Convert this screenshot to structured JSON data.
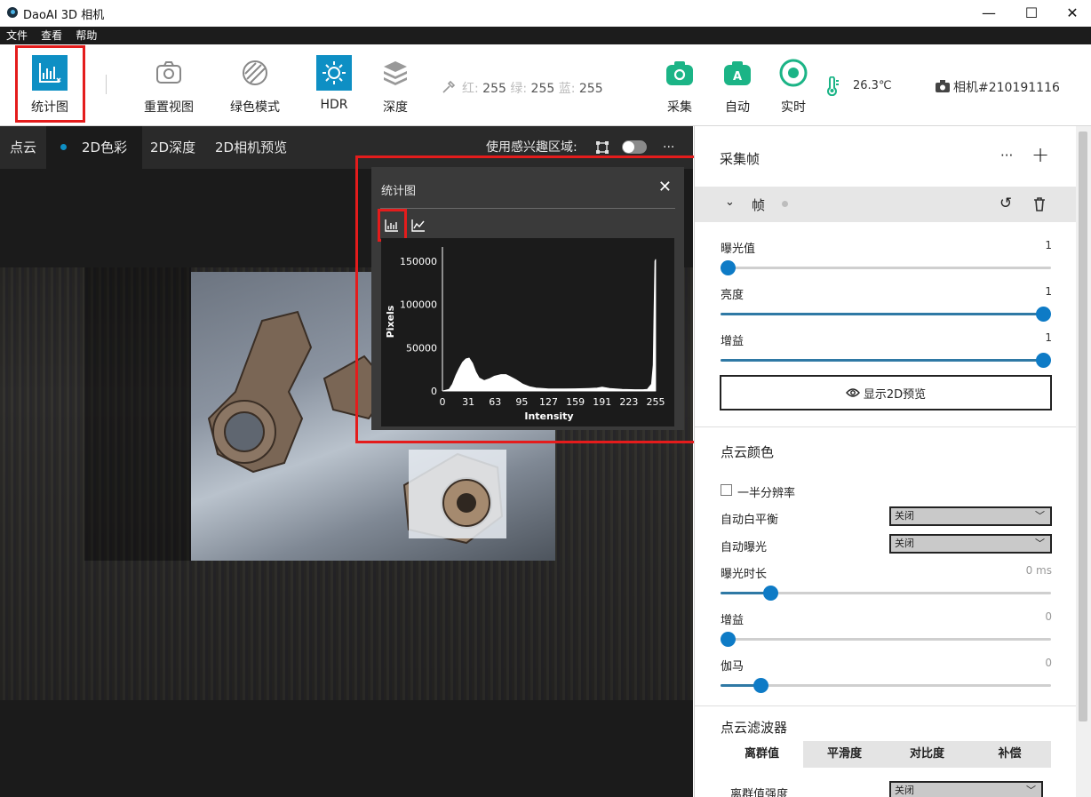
{
  "app": {
    "title": "DaoAI 3D 相机",
    "window_buttons": {
      "minimize": "—",
      "maximize": "☐",
      "close": "✕"
    }
  },
  "menu": [
    "文件",
    "查看",
    "帮助"
  ],
  "toolbar": {
    "stats": "统计图",
    "reset_view": "重置视图",
    "green_mode": "绿色模式",
    "hdr": "HDR",
    "depth": "深度",
    "rgb_r_label": "红:",
    "rgb_r": "255",
    "rgb_g_label": "绿:",
    "rgb_g": "255",
    "rgb_b_label": "蓝:",
    "rgb_b": "255",
    "capture": "采集",
    "auto": "自动",
    "live": "实时",
    "temperature": "26.3℃",
    "camera": "相机#210191116",
    "accent": "#0e8fc4",
    "green_accent": "#1bb486"
  },
  "viewer": {
    "tabs": [
      "点云",
      "2D色彩",
      "2D深度",
      "2D相机预览"
    ],
    "active_tab": "2D色彩",
    "roi_label": "使用感兴趣区域:",
    "roi_enabled": false,
    "more": "···"
  },
  "histogram": {
    "title": "统计图",
    "close": "✕",
    "chart_data": {
      "type": "area",
      "xlabel": "Intensity",
      "ylabel": "Pixels",
      "xticks": [
        "0",
        "31",
        "63",
        "95",
        "127",
        "159",
        "191",
        "223",
        "255"
      ],
      "yticks": [
        "0",
        "50000",
        "100000",
        "150000"
      ],
      "xlim": [
        0,
        255
      ],
      "ylim": [
        0,
        160000
      ],
      "x": [
        0,
        8,
        12,
        16,
        20,
        24,
        28,
        32,
        36,
        40,
        44,
        50,
        56,
        62,
        70,
        76,
        80,
        88,
        96,
        104,
        112,
        120,
        127,
        140,
        159,
        175,
        185,
        191,
        200,
        215,
        230,
        240,
        245,
        250,
        252,
        253,
        254,
        255
      ],
      "y": [
        0,
        2000,
        8000,
        18000,
        26000,
        33000,
        37000,
        38000,
        32000,
        22000,
        15000,
        12000,
        14000,
        17000,
        19000,
        19000,
        17000,
        13000,
        8000,
        5000,
        3500,
        3000,
        2500,
        2400,
        2600,
        3000,
        3400,
        4500,
        3000,
        2000,
        1500,
        1500,
        2000,
        8000,
        30000,
        90000,
        150000,
        152000
      ]
    }
  },
  "panel": {
    "frames_title": "采集帧",
    "frame_label": "帧",
    "exposure_label": "曝光值",
    "exposure_value": "1",
    "exposure_frac": 0.0,
    "brightness_label": "亮度",
    "brightness_value": "1",
    "brightness_frac": 1.0,
    "gain_label": "增益",
    "gain_value": "1",
    "gain_frac": 1.0,
    "show_2d_preview": "显示2D预览",
    "pc_color_title": "点云颜色",
    "half_res": "一半分辨率",
    "awb_label": "自动白平衡",
    "awb_value": "关闭",
    "ae_label": "自动曝光",
    "ae_value": "关闭",
    "exp_time_label": "曝光时长",
    "exp_time_value": "0 ms",
    "exp_time_frac": 0.15,
    "gain2_label": "增益",
    "gain2_value": "0",
    "gain2_frac": 0.0,
    "gamma_label": "伽马",
    "gamma_value": "0",
    "gamma_frac": 0.12,
    "filter_title": "点云滤波器",
    "filter_tabs": [
      "离群值",
      "平滑度",
      "对比度",
      "补偿"
    ],
    "outlier_label": "离群值强度",
    "outlier_value": "关闭"
  }
}
